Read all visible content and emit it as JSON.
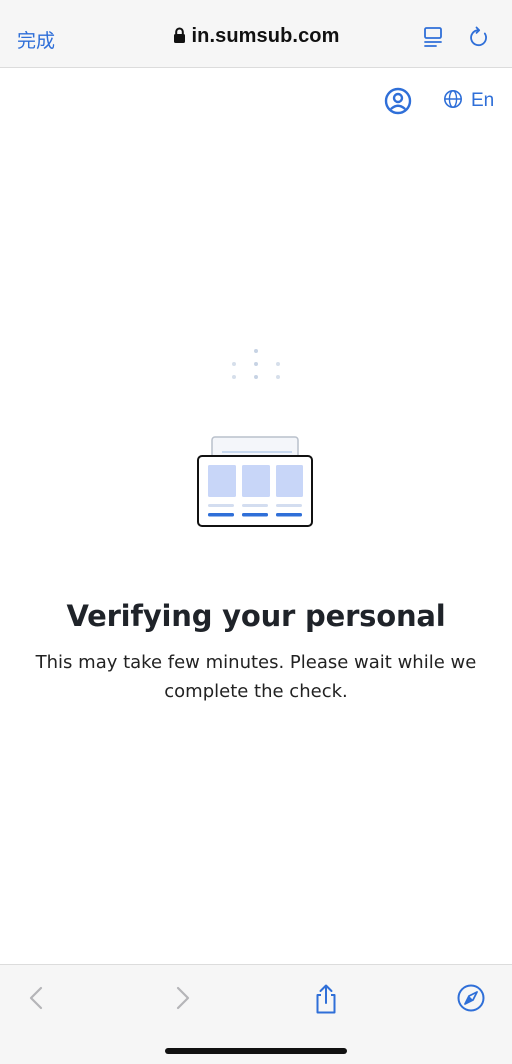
{
  "browser": {
    "done_label": "完成",
    "url": "in.sumsub.com",
    "accent": "#2f6fd8"
  },
  "content": {
    "language_code": "En",
    "title": "Verifying your personal",
    "subtitle": "This may take few minutes. Please wait while we complete the check."
  },
  "toolbar": {
    "icons": [
      "back-icon",
      "forward-icon",
      "share-icon",
      "compass-icon"
    ]
  }
}
